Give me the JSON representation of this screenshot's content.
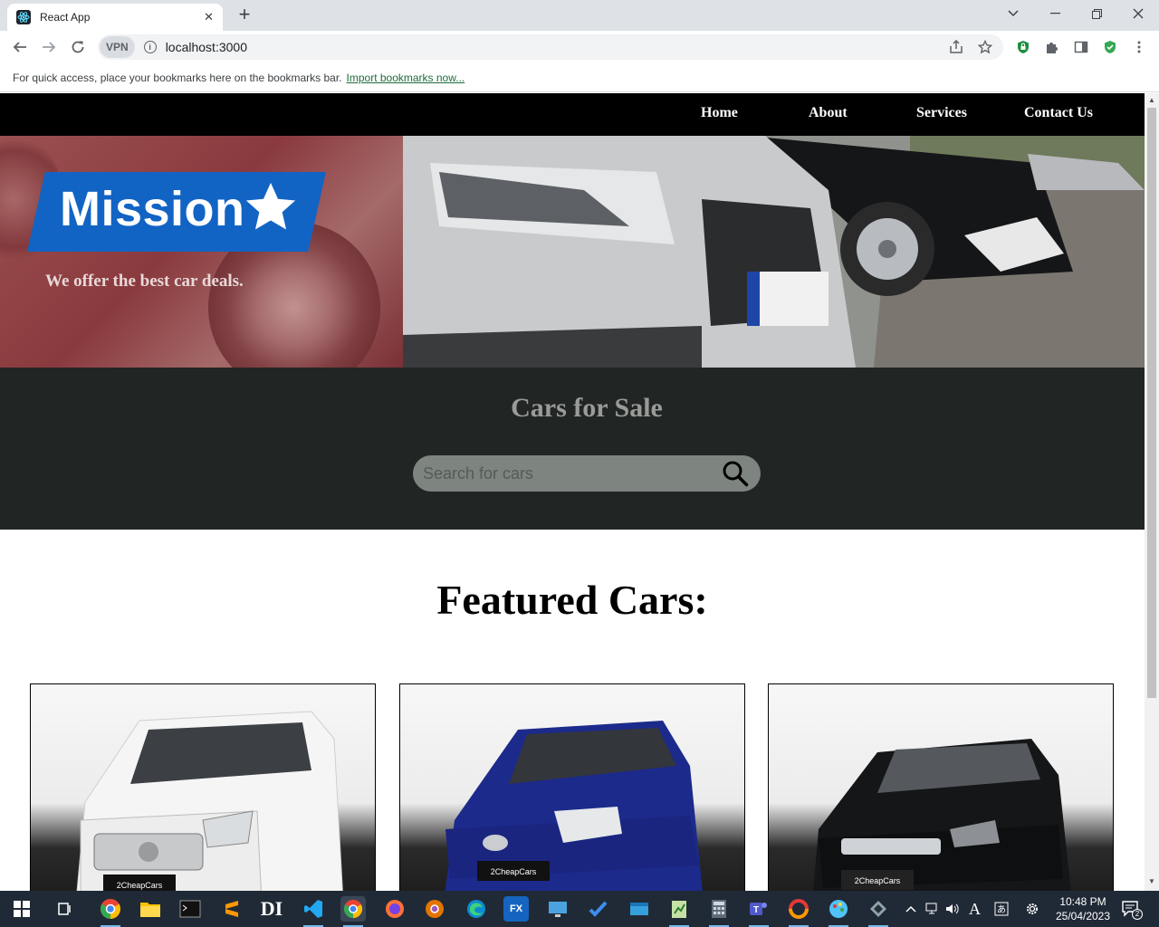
{
  "browser": {
    "tab_title": "React App",
    "url": "localhost:3000",
    "vpn_label": "VPN",
    "bookmarks_hint": "For quick access, place your bookmarks here on the bookmarks bar.",
    "bookmarks_link": "Import bookmarks now..."
  },
  "site": {
    "nav": [
      "Home",
      "About",
      "Services",
      "Contact Us"
    ],
    "hero": {
      "badge": "Mission",
      "tagline": "We offer the best car deals."
    },
    "sale": {
      "title": "Cars for Sale",
      "search_placeholder": "Search for cars"
    },
    "featured_title": "Featured Cars:",
    "cars": [
      {
        "color": "#f4f4f4",
        "plate": "2CheapCars"
      },
      {
        "color": "#1c2a8c",
        "plate": "2CheapCars"
      },
      {
        "color": "#151618",
        "plate": "2CheapCars"
      }
    ]
  },
  "taskbar": {
    "time": "10:48 PM",
    "date": "25/04/2023",
    "notifications": "2"
  }
}
